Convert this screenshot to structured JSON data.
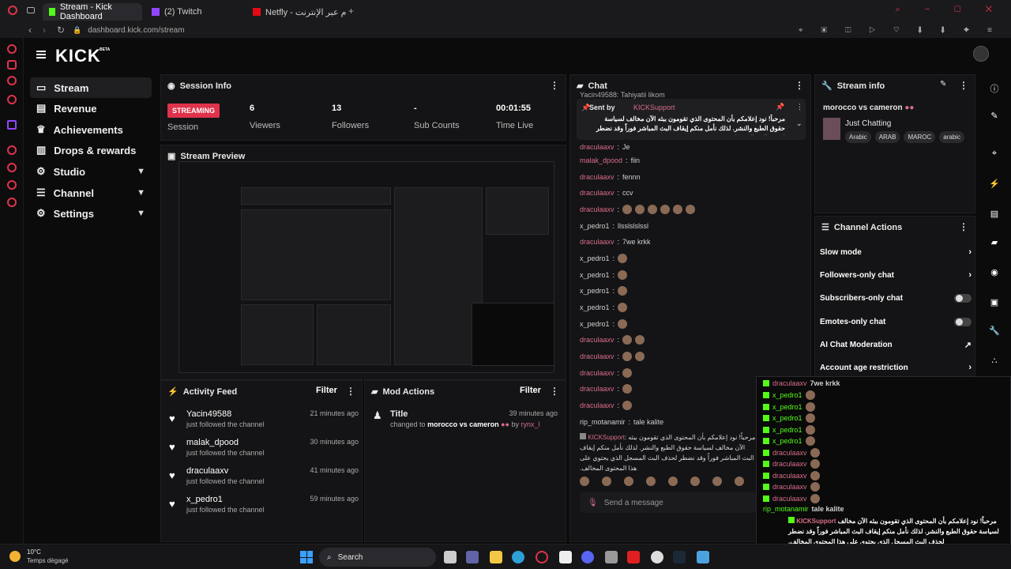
{
  "browser": {
    "tabs": [
      {
        "label": "Stream - Kick Dashboard"
      },
      {
        "label": "(2) Twitch"
      },
      {
        "label": "Netfly - الأفلام عبر الإنترنت"
      }
    ],
    "url": "dashboard.kick.com/stream"
  },
  "app": {
    "logo": "KICK",
    "beta": "BETA"
  },
  "sidebar": {
    "items": [
      {
        "label": "Stream"
      },
      {
        "label": "Revenue"
      },
      {
        "label": "Achievements"
      },
      {
        "label": "Drops & rewards"
      },
      {
        "label": "Studio"
      },
      {
        "label": "Channel"
      },
      {
        "label": "Settings"
      }
    ]
  },
  "session": {
    "title": "Session Info",
    "badge": "STREAMING",
    "badge_caption": "Session",
    "stats": [
      {
        "value": "6",
        "label": "Viewers"
      },
      {
        "value": "13",
        "label": "Followers"
      },
      {
        "value": "-",
        "label": "Sub Counts"
      },
      {
        "value": "00:01:55",
        "label": "Time Live"
      }
    ]
  },
  "preview": {
    "title": "Stream Preview"
  },
  "activity": {
    "title": "Activity Feed",
    "filter": "Filter",
    "items": [
      {
        "name": "Yacin49588",
        "sub": "just followed the channel",
        "time": "21 minutes ago"
      },
      {
        "name": "malak_dpood",
        "sub": "just followed the channel",
        "time": "30 minutes ago"
      },
      {
        "name": "draculaaxv",
        "sub": "just followed the channel",
        "time": "41 minutes ago"
      },
      {
        "name": "x_pedro1",
        "sub": "just followed the channel",
        "time": "59 minutes ago"
      }
    ]
  },
  "mod": {
    "title": "Mod Actions",
    "filter": "Filter",
    "item": {
      "name": "Title",
      "time": "39 minutes ago",
      "pre": "changed to",
      "value": "morocco vs cameron",
      "by": "by",
      "user": "rynx_l"
    }
  },
  "chat": {
    "title": "Chat",
    "pinned_top": "Yacin49588: Tahiyatii likom",
    "pinned_by": "Sent by",
    "pinned_user": "KICKSupport",
    "pinned_text": "مرحباً! نود إعلامكم بأن المحتوى الذي تقومون ببثه الآن مخالف لسياسة حقوق الطبع والنشر. لذلك نأمل منكم إيقاف البث المباشر فوراً وقد نضطر لحذف البث المسجل...",
    "messages": [
      {
        "user": "draculaaxv",
        "text": "Je"
      },
      {
        "user": "malak_dpood",
        "text": "fiin"
      },
      {
        "user": "draculaaxv",
        "text": "fennn"
      },
      {
        "user": "draculaaxv",
        "text": "ccv"
      },
      {
        "user": "draculaaxv",
        "text": ""
      },
      {
        "user": "x_pedro1",
        "text": "llsslslslssl"
      },
      {
        "user": "draculaaxv",
        "text": "7we krkk"
      },
      {
        "user": "x_pedro1",
        "text": ""
      },
      {
        "user": "x_pedro1",
        "text": ""
      },
      {
        "user": "x_pedro1",
        "text": ""
      },
      {
        "user": "x_pedro1",
        "text": ""
      },
      {
        "user": "x_pedro1",
        "text": ""
      },
      {
        "user": "draculaaxv",
        "text": ""
      },
      {
        "user": "draculaaxv",
        "text": ""
      },
      {
        "user": "draculaaxv",
        "text": ""
      },
      {
        "user": "draculaaxv",
        "text": ""
      },
      {
        "user": "draculaaxv",
        "text": ""
      },
      {
        "user": "rip_motanamir",
        "text": "tale kalite"
      }
    ],
    "support_user": "KICKSupport",
    "support_text": "مرحباً! نود إعلامكم بأن المحتوى الذي تقومون ببثه الآن مخالف لسياسة حقوق الطبع والنشر. لذلك نأمل منكم إيقاف البث المباشر فوراً وقد نضطر لحذف البث المسجل الذي يحتوي على هذا المحتوى المخالف.",
    "input_placeholder": "Send a message"
  },
  "streaminfo": {
    "title": "Stream info",
    "stream_title": "morocco vs cameron",
    "category": "Just Chatting",
    "tags": [
      "Arabic",
      "ARAB",
      "MAROC",
      "arabic"
    ]
  },
  "actions": {
    "title": "Channel Actions",
    "items": [
      {
        "label": "Slow mode"
      },
      {
        "label": "Followers-only chat"
      },
      {
        "label": "Subscribers-only chat"
      },
      {
        "label": "Emotes-only chat"
      },
      {
        "label": "AI Chat Moderation"
      },
      {
        "label": "Account age restriction"
      }
    ]
  },
  "overlay": {
    "lines": [
      {
        "user": "draculaaxv",
        "text": "7we krkk"
      },
      {
        "user": "x_pedro1",
        "text": ""
      },
      {
        "user": "x_pedro1",
        "text": ""
      },
      {
        "user": "x_pedro1",
        "text": ""
      },
      {
        "user": "x_pedro1",
        "text": ""
      },
      {
        "user": "x_pedro1",
        "text": ""
      },
      {
        "user": "draculaaxv",
        "text": ""
      },
      {
        "user": "draculaaxv",
        "text": ""
      },
      {
        "user": "draculaaxv",
        "text": ""
      },
      {
        "user": "draculaaxv",
        "text": ""
      },
      {
        "user": "draculaaxv",
        "text": ""
      },
      {
        "user": "rip_motanamir",
        "text": "tale kalite"
      }
    ],
    "support_user": "KICKSupport",
    "support_text": "مرحباً! نود إعلامكم بأن المحتوى الذي تقومون ببثه الآن مخالف لسياسة حقوق الطبع والنشر. لذلك نأمل منكم إيقاف البث المباشر فوراً وقد نضطر لحذف البث المسجل الذي يحتوي على هذا المحتوى المخالف."
  },
  "taskbar": {
    "weather_temp": "10°C",
    "weather_desc": "Temps dégagé",
    "search": "Search"
  },
  "colors": {
    "kick_green": "#53fc18",
    "live_red": "#e0334b",
    "pink_user": "#d86d8a"
  }
}
